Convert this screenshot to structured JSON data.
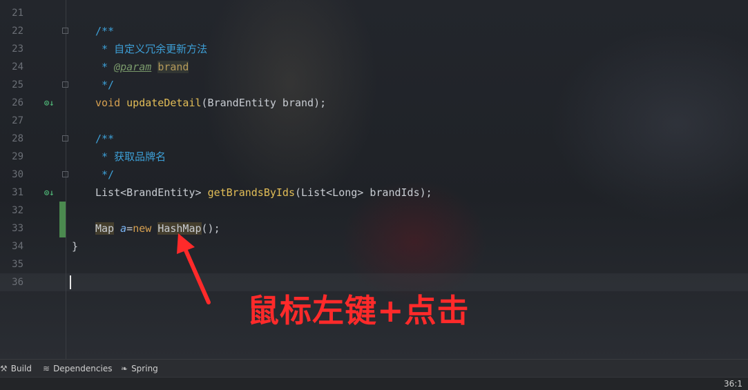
{
  "editor": {
    "line_numbers": [
      "21",
      "22",
      "23",
      "24",
      "25",
      "26",
      "27",
      "28",
      "29",
      "30",
      "31",
      "32",
      "33",
      "34",
      "35",
      "36"
    ],
    "lines": {
      "l22": "/**",
      "l23": " * 自定义冗余更新方法",
      "l24_star": " * ",
      "l24_tag": "@param",
      "l24_name": "brand",
      "l25": " */",
      "l26_kw": "void",
      "l26_fn": "updateDetail",
      "l26_rest": "(BrandEntity brand);",
      "l28": "/**",
      "l29": " * 获取品牌名",
      "l30": " */",
      "l31_type": "List<BrandEntity>",
      "l31_fn": "getBrandsByIds",
      "l31_rest": "(List<Long> brandIds);",
      "l33_type": "Map",
      "l33_var": "a",
      "l33_eq": "=",
      "l33_new": "new",
      "l33_class": "HashMap",
      "l33_rest": "();",
      "l34": "}"
    }
  },
  "annotation": {
    "text": "鼠标左键+点击",
    "color": "#ff2a2a"
  },
  "toolbar": {
    "build_label": "Build",
    "dependencies_label": "Dependencies",
    "spring_label": "Spring"
  },
  "status": {
    "caret_position": "36:1"
  }
}
